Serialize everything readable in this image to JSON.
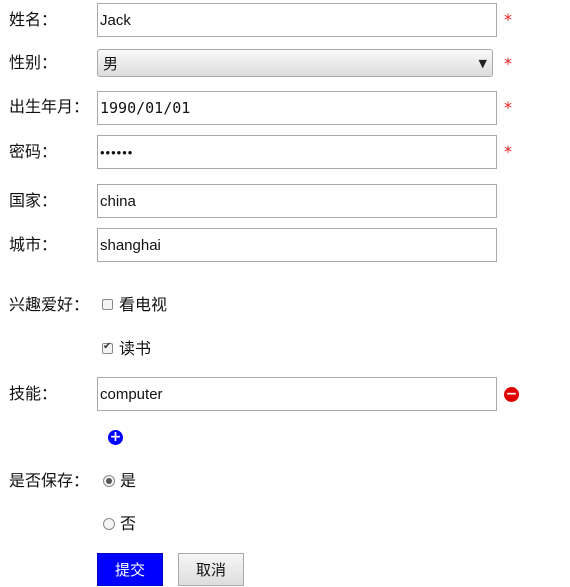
{
  "form": {
    "name_label": "姓名：",
    "name_value": "Jack",
    "gender_label": "性别：",
    "gender_value": "男",
    "birth_label": "出生年月：",
    "birth_value": "1990/01/01",
    "password_label": "密码：",
    "password_value": "••••••",
    "country_label": "国家：",
    "country_value": "china",
    "city_label": "城市：",
    "city_value": "shanghai",
    "hobby_label": "兴趣爱好：",
    "hobbies": [
      {
        "label": "看电视",
        "checked": false
      },
      {
        "label": "读书",
        "checked": true
      }
    ],
    "skill_label": "技能：",
    "skill_value": "computer",
    "save_label": "是否保存：",
    "save_options": [
      {
        "label": "是",
        "selected": true
      },
      {
        "label": "否",
        "selected": false
      }
    ],
    "required_mark": "*",
    "submit_label": "提交",
    "cancel_label": "取消",
    "remove_symbol": "−",
    "add_symbol": "+"
  },
  "colors": {
    "required": "#e02020",
    "remove_button": "#e00000",
    "add_button": "#0000ff",
    "submit_bg": "#0000ff"
  }
}
